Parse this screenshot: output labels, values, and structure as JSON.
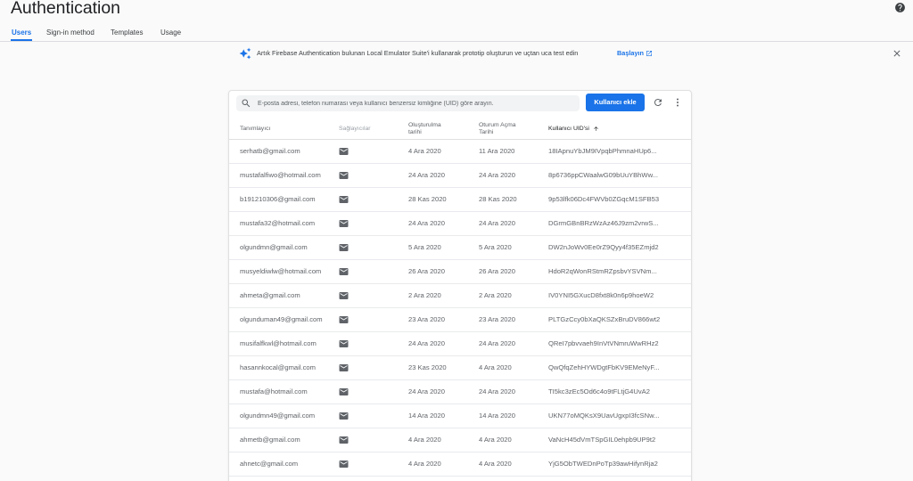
{
  "colors": {
    "accent": "#1a73e8",
    "text": "#202124",
    "muted": "#5f6368",
    "divider": "#e0e0e0"
  },
  "header": {
    "title": "Authentication",
    "help_icon": "help-icon"
  },
  "tabs": [
    {
      "label": "Users",
      "active": true
    },
    {
      "label": "Sign-in method",
      "active": false
    },
    {
      "label": "Templates",
      "active": false
    },
    {
      "label": "Usage",
      "active": false
    }
  ],
  "banner": {
    "icon": "sparkle-icon",
    "text": "Artık Firebase Authentication bulunan Local Emulator Suite'i kullanarak prototip oluşturun ve uçtan uca test edin",
    "link_label": "Başlayın",
    "link_icon": "external-link-icon",
    "close_icon": "close-icon"
  },
  "users_table": {
    "search": {
      "icon": "search-icon",
      "placeholder": "E-posta adresi, telefon numarası veya kullanıcı benzersiz kimliğine (UID) göre arayın.",
      "value": ""
    },
    "add_user_label": "Kullanıcı ekle",
    "refresh_icon": "refresh-icon",
    "more_icon": "more-vert-icon",
    "columns": [
      {
        "label": "Tanımlayıcı"
      },
      {
        "label": "Sağlayıcılar"
      },
      {
        "label": "Oluşturulma tarihi"
      },
      {
        "label": "Oturum Açma Tarihi"
      },
      {
        "label": "Kullanıcı UID'si",
        "sort_icon": "arrow-up-icon"
      }
    ],
    "rows": [
      {
        "identifier": "serhatb@gmail.com",
        "provider": "email-icon",
        "created": "4 Ara 2020",
        "signed_in": "11 Ara 2020",
        "uid": "18IApnuYbJM9IVpqbPhmnaHUp6..."
      },
      {
        "identifier": "mustafalfiwo@hotmail.com",
        "provider": "email-icon",
        "created": "24 Ara 2020",
        "signed_in": "24 Ara 2020",
        "uid": "8p6736ppCWaalwG09bUuYBhWw..."
      },
      {
        "identifier": "b191210306@gmail.com",
        "provider": "email-icon",
        "created": "28 Kas 2020",
        "signed_in": "28 Kas 2020",
        "uid": "9p53lfk06Dc4FWVb0ZGqcM1SFB53"
      },
      {
        "identifier": "mustafa32@hotmail.com",
        "provider": "email-icon",
        "created": "24 Ara 2020",
        "signed_in": "24 Ara 2020",
        "uid": "DGrmGBnBRzWzAz46J9zm2vrwS..."
      },
      {
        "identifier": "olgundmn@gmail.com",
        "provider": "email-icon",
        "created": "5 Ara 2020",
        "signed_in": "5 Ara 2020",
        "uid": "DW2nJoWv0Ee0rZ9Qyy4f35EZmjd2"
      },
      {
        "identifier": "musyeldiwlw@hotmail.com",
        "provider": "email-icon",
        "created": "26 Ara 2020",
        "signed_in": "26 Ara 2020",
        "uid": "HdoR2qWonRStmRZpsbvYSVNm..."
      },
      {
        "identifier": "ahmeta@gmail.com",
        "provider": "email-icon",
        "created": "2 Ara 2020",
        "signed_in": "2 Ara 2020",
        "uid": "IV0YNI5GXucD8fxt8k0n6p9hoeW2"
      },
      {
        "identifier": "olgunduman49@gmail.com",
        "provider": "email-icon",
        "created": "23 Ara 2020",
        "signed_in": "23 Ara 2020",
        "uid": "PLTGzCcy0bXaQKSZxBruDV866wt2"
      },
      {
        "identifier": "musifalfkwl@hotmail.com",
        "provider": "email-icon",
        "created": "24 Ara 2020",
        "signed_in": "24 Ara 2020",
        "uid": "QReI7pbvvaeh9InVtVNmruWwRHz2"
      },
      {
        "identifier": "hasannkocal@gmail.com",
        "provider": "email-icon",
        "created": "23 Kas 2020",
        "signed_in": "4 Ara 2020",
        "uid": "QwQfqZehHYWDgtFbKV9EMeNyF..."
      },
      {
        "identifier": "mustafa@hotmail.com",
        "provider": "email-icon",
        "created": "24 Ara 2020",
        "signed_in": "24 Ara 2020",
        "uid": "TI5kc3zEc5Od6c4o9tFLtjG4UvA2"
      },
      {
        "identifier": "olgundmn49@gmail.com",
        "provider": "email-icon",
        "created": "14 Ara 2020",
        "signed_in": "14 Ara 2020",
        "uid": "UKN77oMQKsX9UavUgxpI3fcSNw..."
      },
      {
        "identifier": "ahmetb@gmail.com",
        "provider": "email-icon",
        "created": "4 Ara 2020",
        "signed_in": "4 Ara 2020",
        "uid": "VaNcH45dVmTSpGIL0ehpb9UP9t2"
      },
      {
        "identifier": "ahnetc@gmail.com",
        "provider": "email-icon",
        "created": "4 Ara 2020",
        "signed_in": "4 Ara 2020",
        "uid": "YjG5ObTWEDnPoTp39awHifynRja2"
      }
    ]
  }
}
